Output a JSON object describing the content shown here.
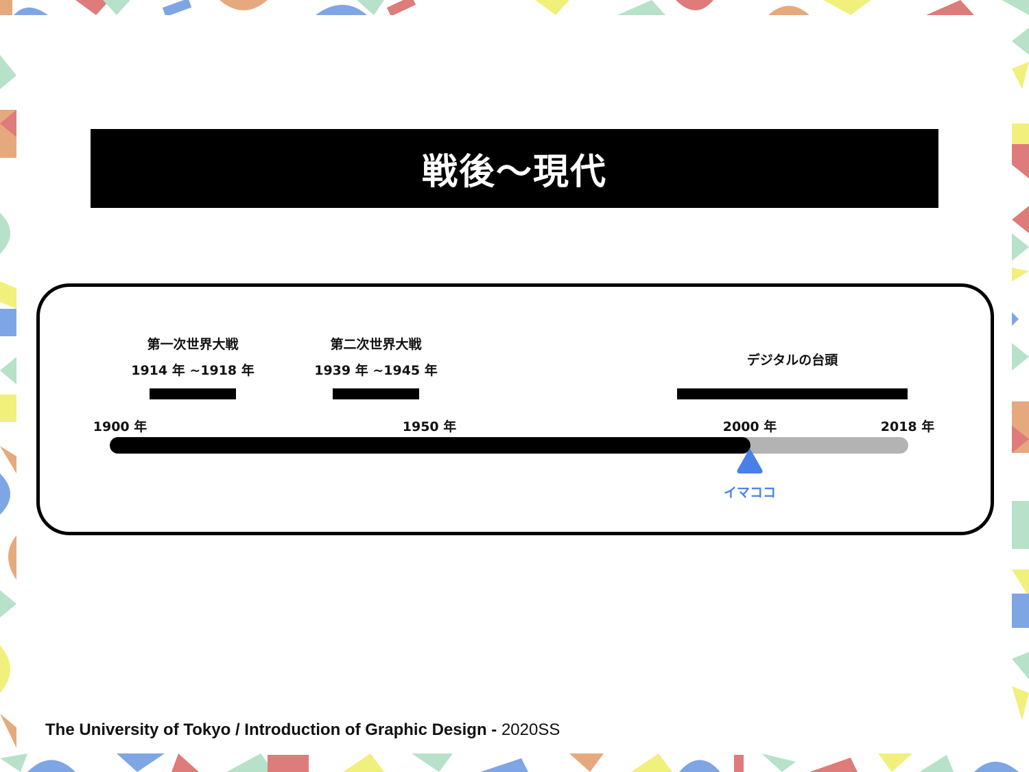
{
  "slide": {
    "title": "戦後〜現代",
    "footer_main": "The University of Tokyo / Introduction of Graphic Design - ",
    "footer_term": "2020SS"
  },
  "timeline": {
    "axis_labels": [
      "1900 年",
      "1950 年",
      "2000 年",
      "2018 年"
    ],
    "events": [
      {
        "name": "第一次世界大戦",
        "period": "1914 年 ~1918 年"
      },
      {
        "name": "第二次世界大戦",
        "period": "1939 年 ~1945 年"
      },
      {
        "name": "デジタルの台頭"
      }
    ],
    "now_marker": "イマココ",
    "colors": {
      "past": "#000000",
      "future": "#b3b3b3",
      "marker": "#4a7fe8"
    }
  },
  "colors": {
    "banner": "#000000",
    "decor": [
      "#f1f07c",
      "#e6a97d",
      "#b7e2c9",
      "#7fa6e4",
      "#de7b7b"
    ]
  }
}
